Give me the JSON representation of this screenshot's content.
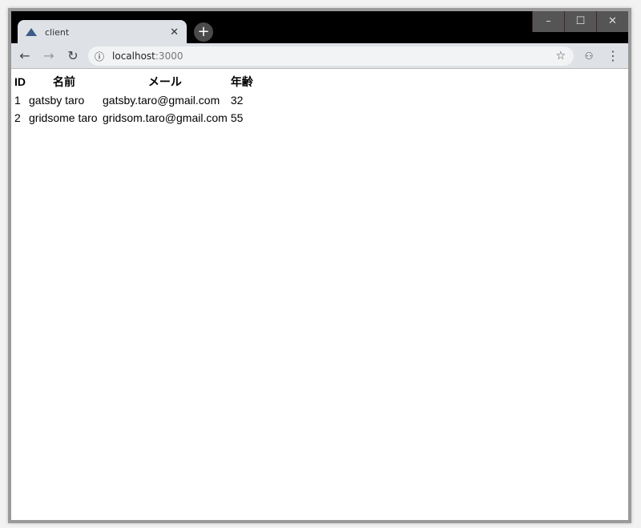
{
  "browser": {
    "tab_title": "client",
    "url_host": "localhost",
    "url_port": ":3000",
    "icons": {
      "favicon": "triangle-logo",
      "back": "arrow-left",
      "forward": "arrow-right",
      "reload": "refresh",
      "info": "info-circle",
      "bookmark": "star",
      "incognito": "incognito",
      "menu": "kebab"
    }
  },
  "table": {
    "headers": [
      "ID",
      "名前",
      "メール",
      "年齢"
    ],
    "rows": [
      [
        "1",
        "gatsby taro",
        "gatsby.taro@gmail.com",
        "32"
      ],
      [
        "2",
        "gridsome taro",
        "gridsom.taro@gmail.com",
        "55"
      ]
    ]
  }
}
